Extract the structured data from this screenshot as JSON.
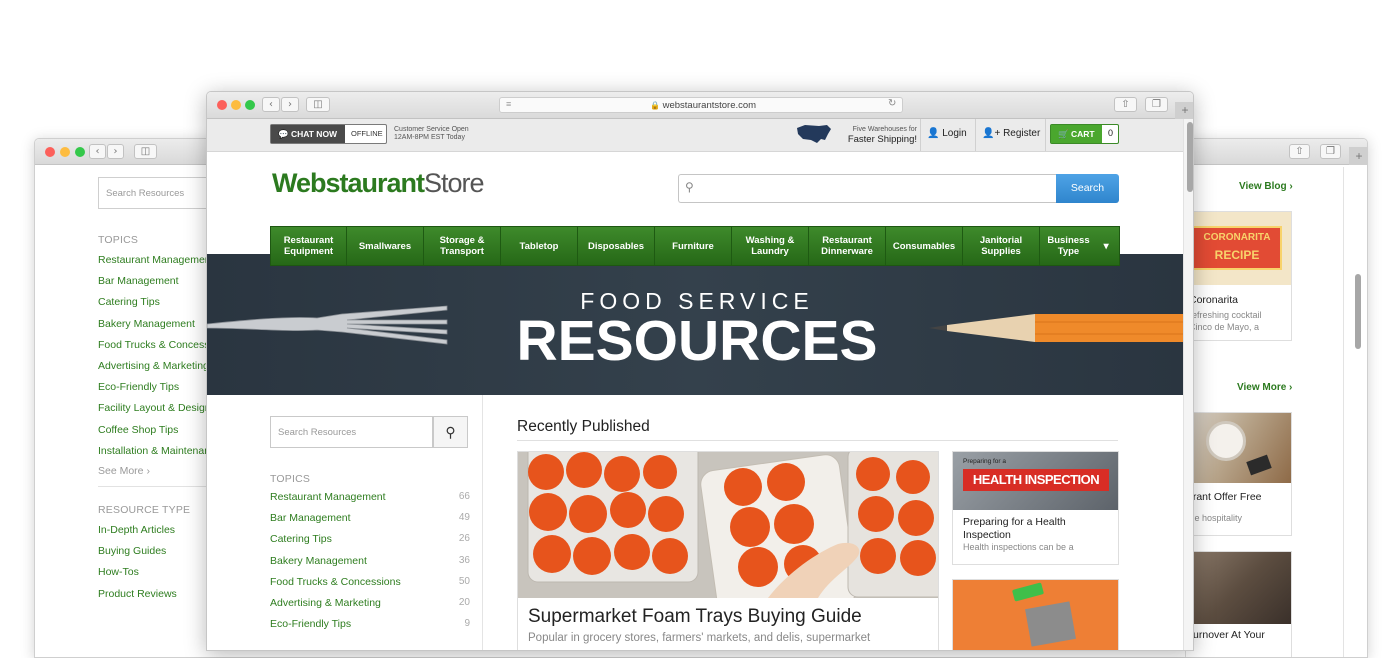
{
  "back_window": {
    "search_placeholder": "Search Resources",
    "topics_heading": "TOPICS",
    "topics": [
      "Restaurant Management",
      "Bar Management",
      "Catering Tips",
      "Bakery Management",
      "Food Trucks & Concessions",
      "Advertising & Marketing",
      "Eco-Friendly Tips",
      "Facility Layout & Design",
      "Coffee Shop Tips",
      "Installation & Maintenance"
    ],
    "see_more": "See More",
    "resource_type_heading": "RESOURCE TYPE",
    "resource_types": [
      "In-Depth Articles",
      "Buying Guides",
      "How-Tos",
      "Product Reviews"
    ],
    "view_blog": "View Blog",
    "view_more": "View More",
    "card1_image_text": [
      "CORONARITA",
      "RECIPE"
    ],
    "card1_title": "Coronarita",
    "card1_snippet": [
      "refreshing cocktail",
      "Cinco de Mayo, a"
    ],
    "card2_title": "urant Offer Free",
    "card2_snippet": "the hospitality",
    "card3_title": "Turnover At Your"
  },
  "front_window": {
    "url": "webstaurantstore.com",
    "chat_now": "CHAT NOW",
    "offline": "OFFLINE",
    "service_line1": "Customer Service Open",
    "service_line2": "12AM-8PM EST Today",
    "warehouse_line1": "Five Warehouses for",
    "warehouse_line2": "Faster Shipping!",
    "login": "Login",
    "register": "Register",
    "cart": "CART",
    "cart_count": "0",
    "logo_left": "Webstaurant",
    "logo_right": "Store",
    "search_button": "Search",
    "nav": [
      {
        "l1": "Restaurant",
        "l2": "Equipment"
      },
      {
        "l1": "Smallwares",
        "l2": ""
      },
      {
        "l1": "Storage &",
        "l2": "Transport"
      },
      {
        "l1": "Tabletop",
        "l2": ""
      },
      {
        "l1": "Disposables",
        "l2": ""
      },
      {
        "l1": "Furniture",
        "l2": ""
      },
      {
        "l1": "Washing &",
        "l2": "Laundry"
      },
      {
        "l1": "Restaurant",
        "l2": "Dinnerware"
      },
      {
        "l1": "Consumables",
        "l2": ""
      },
      {
        "l1": "Janitorial",
        "l2": "Supplies"
      },
      {
        "l1": "Business",
        "l2": "Type"
      }
    ],
    "hero_small": "FOOD SERVICE",
    "hero_big": "RESOURCES",
    "search_placeholder": "Search Resources",
    "topics_heading": "TOPICS",
    "topics": [
      {
        "name": "Restaurant Management",
        "count": "66"
      },
      {
        "name": "Bar Management",
        "count": "49"
      },
      {
        "name": "Catering Tips",
        "count": "26"
      },
      {
        "name": "Bakery Management",
        "count": "36"
      },
      {
        "name": "Food Trucks & Concessions",
        "count": "50"
      },
      {
        "name": "Advertising & Marketing",
        "count": "20"
      },
      {
        "name": "Eco-Friendly Tips",
        "count": "9"
      }
    ],
    "recently_published": "Recently Published",
    "main_article_title": "Supermarket Foam Trays Buying Guide",
    "main_article_snippet": "Popular in grocery stores, farmers' markets, and delis, supermarket",
    "side_article1_image_small": "Preparing for a",
    "side_article1_image_big": "HEALTH INSPECTION",
    "side_article1_title": "Preparing for a Health Inspection",
    "side_article1_snippet": "Health inspections can be a"
  },
  "colors": {
    "brand_green": "#2c7a1f",
    "nav_green": "#2d6e1e",
    "search_blue": "#3a8fd6",
    "hero_bg": "#2b3640"
  }
}
